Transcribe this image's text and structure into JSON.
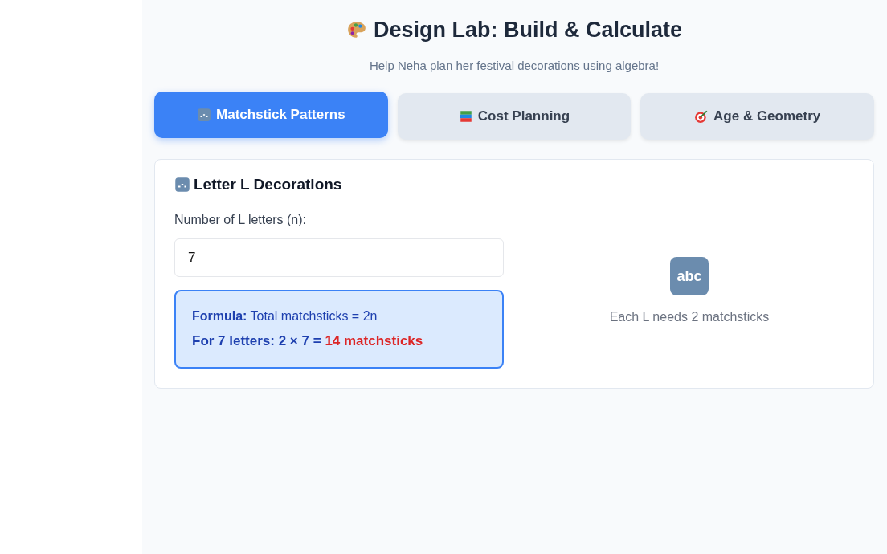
{
  "header": {
    "title": "Design Lab: Build & Calculate",
    "subtitle": "Help Neha plan her festival decorations using algebra!"
  },
  "tabs": [
    {
      "label": "Matchstick Patterns",
      "kind": "letters",
      "selected": true
    },
    {
      "label": "Cost Planning",
      "kind": "books",
      "selected": false
    },
    {
      "label": "Age & Geometry",
      "kind": "target",
      "selected": false
    }
  ],
  "panel": {
    "title": "Letter L Decorations",
    "input_label": "Number of L letters (n):",
    "input_value": "7",
    "formula": "**Formula:** Total matchsticks = 2n",
    "calculation": "For 7 letters: 2 × 7 =",
    "result": "14 matchsticks",
    "illustration_text": "abc",
    "caption": "Each L needs 2 matchsticks"
  }
}
